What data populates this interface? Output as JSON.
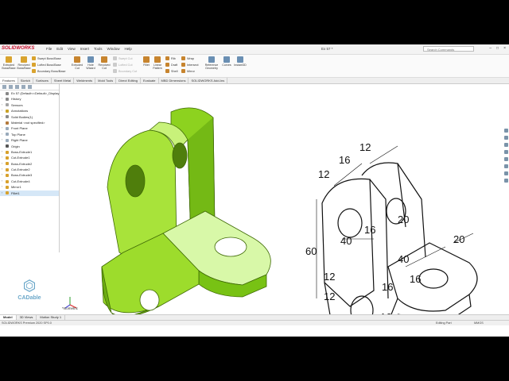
{
  "app": {
    "logo": "SOLIDWORKS",
    "menu": [
      "File",
      "Edit",
      "View",
      "Insert",
      "Tools",
      "Window",
      "Help"
    ],
    "doc_title": "Ex 57 *",
    "search_placeholder": "Search Commands"
  },
  "ribbon": {
    "extruded_boss": "Extruded Boss/Base",
    "revolved_boss": "Revolved Boss/Base",
    "swept_boss": "Swept Boss/Base",
    "lofted_boss": "Lofted Boss/Base",
    "boundary_boss": "Boundary Boss/Base",
    "extruded_cut": "Extruded Cut",
    "hole_wizard": "Hole Wizard",
    "revolved_cut": "Revolved Cut",
    "swept_cut": "Swept Cut",
    "lofted_cut": "Lofted Cut",
    "boundary_cut": "Boundary Cut",
    "fillet": "Fillet",
    "linear_pattern": "Linear Pattern",
    "rib": "Rib",
    "draft": "Draft",
    "shell": "Shell",
    "wrap": "Wrap",
    "intersect": "Intersect",
    "mirror": "Mirror",
    "reference_geometry": "Reference Geometry",
    "curves": "Curves",
    "instant3d": "Instant3D"
  },
  "tabs": [
    "Features",
    "Sketch",
    "Surfaces",
    "Sheet Metal",
    "Weldments",
    "Mold Tools",
    "Direct Editing",
    "Evaluate",
    "MBD Dimensions",
    "SOLIDWORKS Add-Ins"
  ],
  "tree": {
    "items": [
      {
        "label": "Ex 57  (Default<<Default>_Display Sta",
        "icon": "part-icon",
        "color": "#888"
      },
      {
        "label": "History",
        "icon": "history-icon",
        "color": "#8a8a8a"
      },
      {
        "label": "Sensors",
        "icon": "sensor-icon",
        "color": "#a5a5a5"
      },
      {
        "label": "Annotations",
        "icon": "annotation-icon",
        "color": "#c9a227"
      },
      {
        "label": "Solid Bodies(1)",
        "icon": "solid-body-icon",
        "color": "#8a8a8a"
      },
      {
        "label": "Material <not specified>",
        "icon": "material-icon",
        "color": "#b47a3c"
      },
      {
        "label": "Front Plane",
        "icon": "plane-icon",
        "color": "#9ab"
      },
      {
        "label": "Top Plane",
        "icon": "plane-icon",
        "color": "#9ab"
      },
      {
        "label": "Right Plane",
        "icon": "plane-icon",
        "color": "#9ab"
      },
      {
        "label": "Origin",
        "icon": "origin-icon",
        "color": "#555"
      },
      {
        "label": "Boss-Extrude1",
        "icon": "boss-extrude-icon",
        "color": "#d8a12d"
      },
      {
        "label": "Cut-Extrude1",
        "icon": "cut-extrude-icon",
        "color": "#d8a12d"
      },
      {
        "label": "Boss-Extrude2",
        "icon": "boss-extrude-icon",
        "color": "#d8a12d"
      },
      {
        "label": "Cut-Extrude2",
        "icon": "cut-extrude-icon",
        "color": "#d8a12d"
      },
      {
        "label": "Boss-Extrude3",
        "icon": "boss-extrude-icon",
        "color": "#d8a12d"
      },
      {
        "label": "Cut-Extrude4",
        "icon": "cut-extrude-icon",
        "color": "#d8a12d"
      },
      {
        "label": "Mirror1",
        "icon": "mirror-icon",
        "color": "#d8a12d"
      },
      {
        "label": "Fillet1",
        "icon": "fillet-icon",
        "color": "#d8a12d"
      }
    ],
    "selected_index": 17
  },
  "branding": {
    "cadable": "CADable"
  },
  "viewport": {
    "view_label": "*Isometric",
    "model_color": "#8dd21f",
    "drawing_dims": [
      "12",
      "16",
      "12",
      "60",
      "40",
      "16",
      "20",
      "40",
      "20",
      "12",
      "16",
      "16",
      "16",
      "12"
    ]
  },
  "bottom_tabs": [
    "Model",
    "3D Views",
    "Motion Study 1"
  ],
  "status": {
    "left": "SOLIDWORKS Premium 2020 SP0.0",
    "editing": "Editing Part",
    "units": "MMGS"
  }
}
